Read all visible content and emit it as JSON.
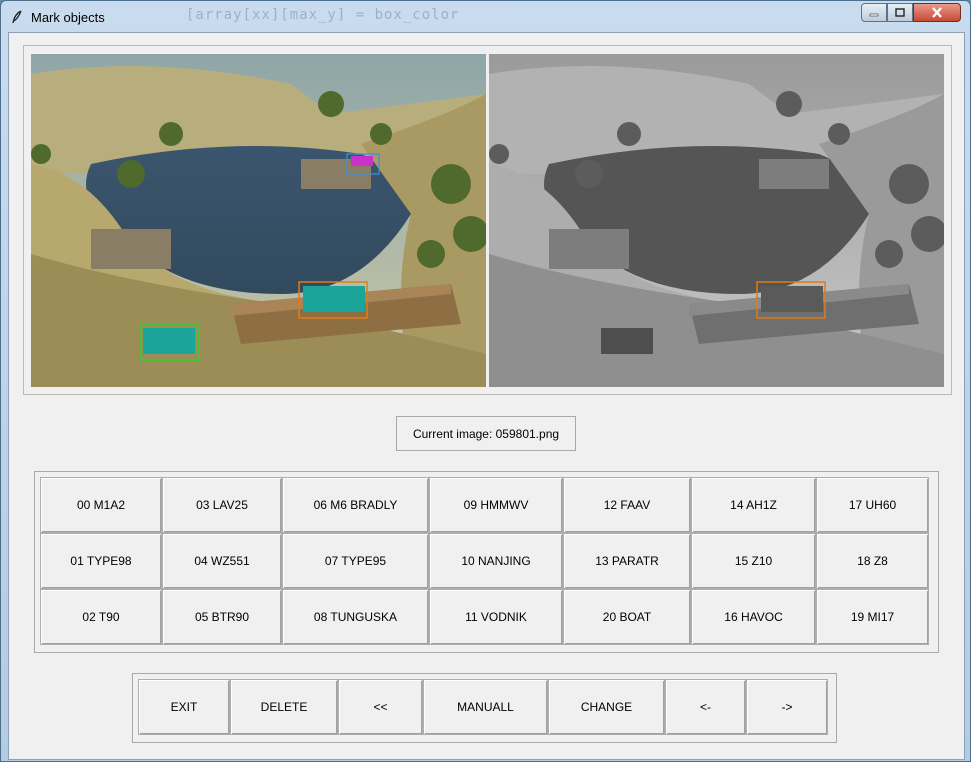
{
  "window": {
    "title": "Mark objects",
    "background_code": "[array[xx][max_y] = box_color"
  },
  "status": {
    "current_image_label": "Current image: 059801.png"
  },
  "classes": [
    [
      "00 M1A2",
      "03 LAV25",
      "06 M6 BRADLY",
      "09 HMMWV",
      "12 FAAV",
      "14 AH1Z",
      "17 UH60"
    ],
    [
      "01 TYPE98",
      "04 WZ551",
      "07 TYPE95",
      "10 NANJING",
      "13 PARATR",
      "15 Z10",
      "18 Z8"
    ],
    [
      "02 T90",
      "05 BTR90",
      "08 TUNGUSKA",
      "11 VODNIK",
      "20 BOAT",
      "16 HAVOC",
      "19 MI17"
    ]
  ],
  "actions": [
    "EXIT",
    "DELETE",
    "<<",
    "MANUALL",
    "CHANGE",
    "<-",
    "->"
  ],
  "colors": {
    "box_orange": "#e07b1a",
    "box_green": "#2fd22f",
    "box_blue": "#3a8fe0",
    "box_magenta": "#d020d0"
  }
}
